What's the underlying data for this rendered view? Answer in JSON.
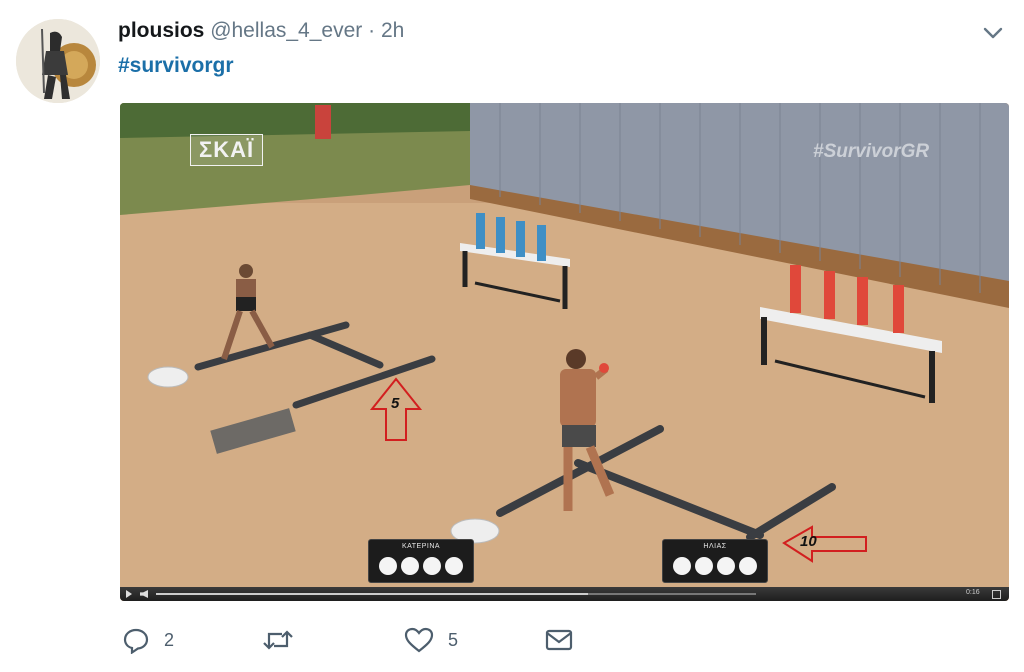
{
  "tweet": {
    "display_name": "plousios",
    "handle": "@hellas_4_ever",
    "separator": "·",
    "time": "2h",
    "hashtag": "#survivorgr"
  },
  "media": {
    "watermark_left": "ΣΚΑΪ",
    "watermark_right": "#SurvivorGR",
    "scoreboard_left": {
      "name": "ΚΑΤΕΡΙΝΑ",
      "dots": 4
    },
    "scoreboard_right": {
      "name": "ΗΛΙΑΣ",
      "dots": 4
    },
    "arrow_left_label": "5",
    "arrow_right_label": "10",
    "player": {
      "time": "0:16",
      "progress": 0.72
    }
  },
  "actions": {
    "replies_count": "2",
    "retweets_count": "",
    "likes_count": "5"
  },
  "colors": {
    "hashtag": "#1b6fa8",
    "handle": "#657786",
    "action_icons": "#4d5e6d",
    "arrow_outline": "#d21f1f"
  },
  "icons": [
    "avatar-spartan",
    "chevron-down-icon",
    "reply-icon",
    "retweet-icon",
    "like-icon",
    "message-icon"
  ]
}
